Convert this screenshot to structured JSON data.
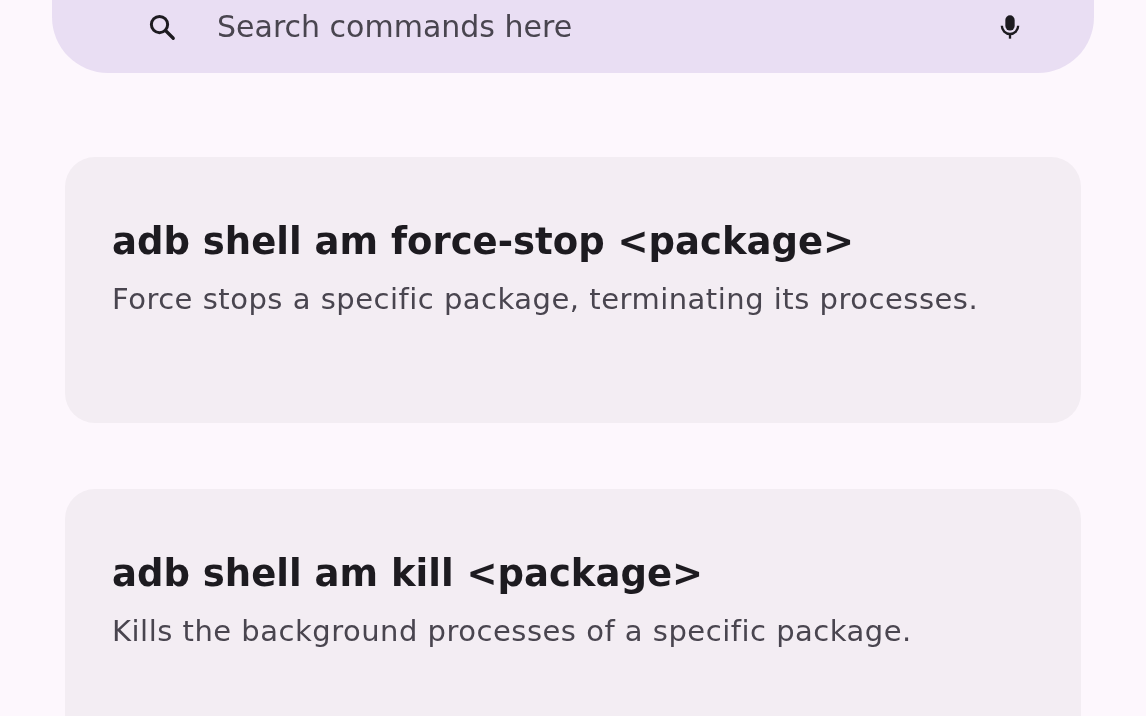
{
  "search": {
    "placeholder": "Search commands here"
  },
  "commands": [
    {
      "command": "adb shell am force-stop <package>",
      "description": "Force stops a specific package, terminating its processes."
    },
    {
      "command": "adb shell am kill <package>",
      "description": "Kills the background processes of a specific package."
    }
  ]
}
